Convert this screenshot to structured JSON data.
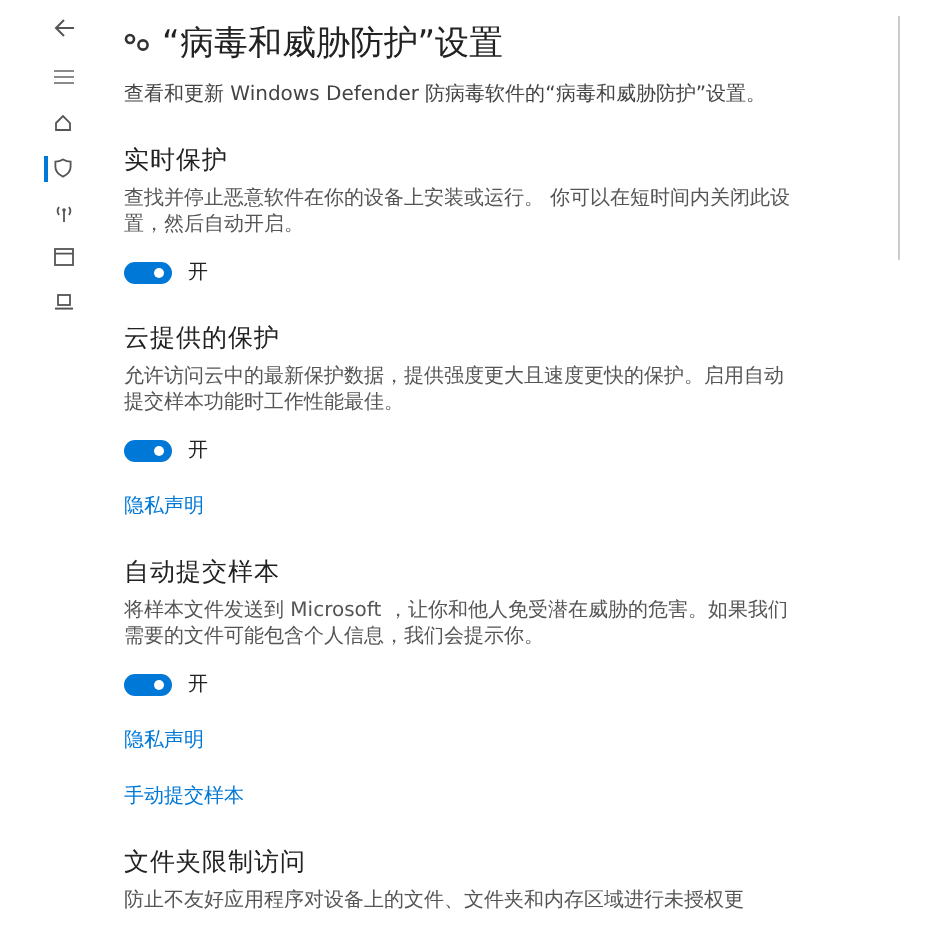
{
  "nav": [
    {
      "kind": "back",
      "selected": false
    },
    {
      "kind": "menu",
      "selected": false
    },
    {
      "kind": "home",
      "selected": false
    },
    {
      "kind": "shield",
      "selected": true
    },
    {
      "kind": "antenna",
      "selected": false
    },
    {
      "kind": "browser",
      "selected": false
    },
    {
      "kind": "laptop",
      "selected": false
    }
  ],
  "page": {
    "title": "“病毒和威胁防护”设置",
    "subtitle": "查看和更新 Windows Defender 防病毒软件的“病毒和威胁防护”设置。"
  },
  "sections": [
    {
      "heading": "实时保护",
      "description": "查找并停止恶意软件在你的设备上安装或运行。 你可以在短时间内关闭此设置，然后自动开启。",
      "toggle": {
        "on": true,
        "label": "开"
      }
    },
    {
      "heading": "云提供的保护",
      "description": "允许访问云中的最新保护数据，提供强度更大且速度更快的保护。启用自动提交样本功能时工作性能最佳。",
      "toggle": {
        "on": true,
        "label": "开"
      },
      "links": [
        "隐私声明"
      ]
    },
    {
      "heading": "自动提交样本",
      "description": "将样本文件发送到 Microsoft ，让你和他人免受潜在威胁的危害。如果我们需要的文件可能包含个人信息，我们会提示你。",
      "toggle": {
        "on": true,
        "label": "开"
      },
      "links": [
        "隐私声明",
        "手动提交样本"
      ]
    },
    {
      "heading": "文件夹限制访问",
      "description": "防止不友好应用程序对设备上的文件、文件夹和内存区域进行未授权更"
    }
  ]
}
